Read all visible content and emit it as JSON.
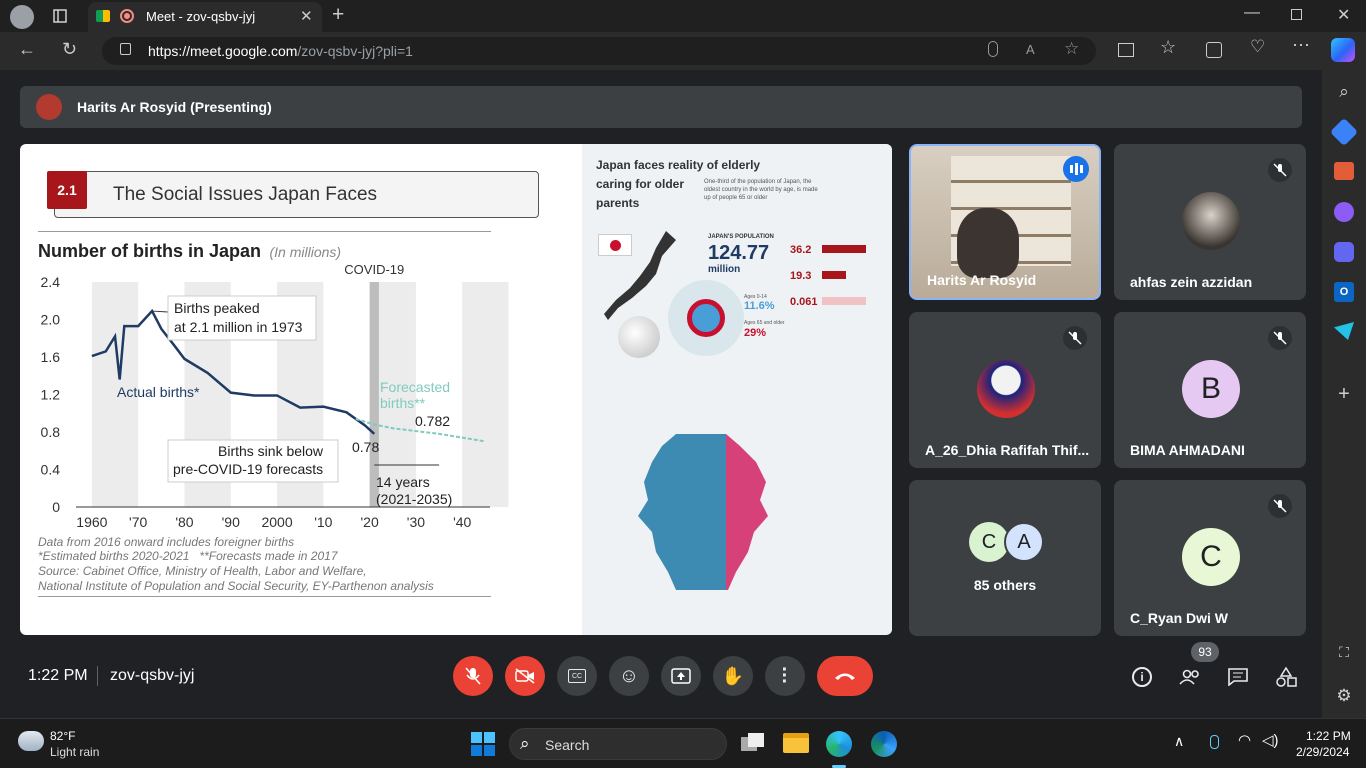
{
  "browser": {
    "tab_title": "Meet - zov-qsbv-jyj",
    "url_host": "https://meet.google.com",
    "url_path": "/zov-qsbv-jyj?pli=1"
  },
  "meet": {
    "presenter_banner": "Harits Ar Rosyid (Presenting)",
    "time": "1:22 PM",
    "meeting_code": "zov-qsbv-jyj",
    "people_count": "93",
    "tiles": [
      {
        "name": "Harits Ar Rosyid"
      },
      {
        "name": "ahfas zein azzidan"
      },
      {
        "name": "A_26_Dhia Rafifah Thif..."
      },
      {
        "name": "BIMA AHMADANI",
        "initial": "B"
      },
      {
        "name": "85 others",
        "initial1": "C",
        "initial2": "A"
      },
      {
        "name": "C_Ryan Dwi W",
        "initial": "C"
      }
    ]
  },
  "slide": {
    "section_num": "2.1",
    "section_title": "The Social Issues Japan Faces",
    "chart_title": "Number of births in Japan",
    "chart_unit": "(In millions)",
    "covid_label": "COVID-19",
    "peak_note_1": "Births peaked",
    "peak_note_2": "at 2.1 million in 1973",
    "actual_label": "Actual births*",
    "forecast_label_1": "Forecasted",
    "forecast_label_2": "births**",
    "val_forecast": "0.782",
    "val_actual": "0.78",
    "sink_note_1": "Births sink below",
    "sink_note_2": "pre-COVID-19 forecasts",
    "gap_note_1": "14 years",
    "gap_note_2": "(2021-2035)",
    "footnote_1": "Data from 2016 onward includes foreigner births",
    "footnote_2": "*Estimated births 2020-2021   **Forecasts made in 2017",
    "footnote_3": "Source: Cabinet Office, Ministry of Health, Labor and Welfare,",
    "footnote_4": "National Institute of Population and Social Security, EY-Parthenon analysis",
    "info_title_1": "Japan faces reality of elderly",
    "info_title_2": "caring for older",
    "info_title_3": "parents",
    "info_sub": "One-third of the population of Japan, the oldest country in the world by age, is made up of people 65 or older",
    "pop_label": "JAPAN'S POPULATION",
    "pop_value": "124.77",
    "pop_unit": "million",
    "age65_value": "36.2",
    "age75_value": "19.3",
    "age100_value": "0.061",
    "age014_label": "Ages 0-14",
    "age014_value": "11.6%",
    "age65p_label": "Ages 65 and older",
    "age65p_value": "29%"
  },
  "chart_data": {
    "type": "line",
    "title": "Number of births in Japan",
    "ylabel": "(In millions)",
    "xlim": [
      1957,
      2046
    ],
    "ylim": [
      0,
      2.4
    ],
    "x_ticks": [
      "1960",
      "'70",
      "'80",
      "'90",
      "2000",
      "'10",
      "'20",
      "'30",
      "'40"
    ],
    "y_ticks": [
      "2.4",
      "2.0",
      "1.6",
      "1.2",
      "0.8",
      "0.4",
      "0"
    ],
    "series": [
      {
        "name": "Actual births*",
        "color": "#1f3b63",
        "x": [
          1960,
          1963,
          1965,
          1966,
          1967,
          1970,
          1973,
          1975,
          1978,
          1980,
          1985,
          1990,
          1995,
          2000,
          2005,
          2010,
          2015,
          2019,
          2021
        ],
        "y": [
          1.61,
          1.66,
          1.82,
          1.36,
          1.93,
          1.93,
          2.09,
          1.9,
          1.71,
          1.58,
          1.43,
          1.22,
          1.19,
          1.19,
          1.06,
          1.07,
          1.01,
          0.87,
          0.78
        ]
      },
      {
        "name": "Forecasted births**",
        "color": "#7fcbbf",
        "x": [
          2017,
          2021,
          2025,
          2030,
          2035,
          2040,
          2045
        ],
        "y": [
          0.94,
          0.88,
          0.84,
          0.81,
          0.78,
          0.74,
          0.7
        ]
      }
    ]
  },
  "taskbar": {
    "temp": "82°F",
    "weather": "Light rain",
    "search": "Search",
    "clock_time": "1:22 PM",
    "clock_date": "2/29/2024"
  },
  "colors": {
    "accent_blue": "#8ab4f8",
    "danger": "#ea4335",
    "slide_red": "#a7161b"
  }
}
